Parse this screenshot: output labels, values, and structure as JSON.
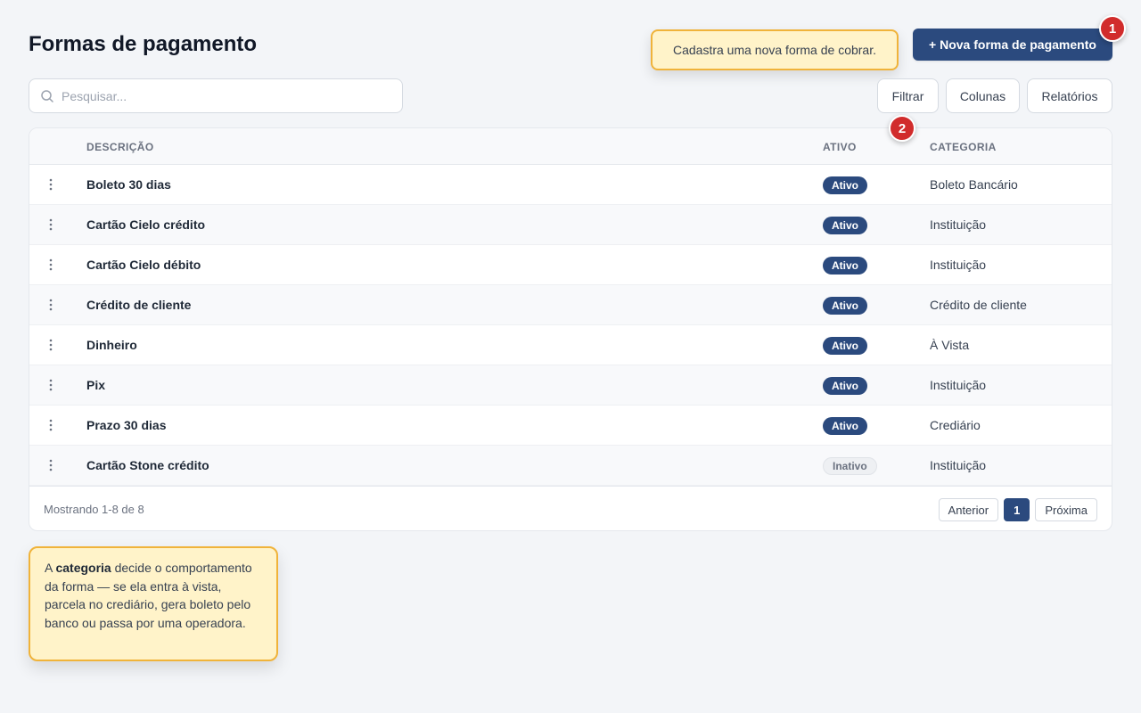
{
  "header": {
    "title": "Formas de pagamento",
    "new_button": "+ Nova forma de pagamento"
  },
  "tooltips": {
    "new_button_hint": "Cadastra uma nova forma de cobrar.",
    "category_prefix": "A ",
    "category_bold": "categoria",
    "category_rest": " decide o comportamento da forma — se ela entra à vista, parcela no crediário, gera boleto pelo banco ou passa por uma operadora."
  },
  "steps": [
    "1",
    "2"
  ],
  "toolbar": {
    "search_placeholder": "Pesquisar...",
    "filter": "Filtrar",
    "columns": "Colunas",
    "reports": "Relatórios"
  },
  "table": {
    "columns": [
      "DESCRIÇÃO",
      "ATIVO",
      "CATEGORIA"
    ],
    "rows": [
      {
        "description": "Boleto 30 dias",
        "status": "Ativo",
        "active": true,
        "category": "Boleto Bancário"
      },
      {
        "description": "Cartão Cielo crédito",
        "status": "Ativo",
        "active": true,
        "category": "Instituição"
      },
      {
        "description": "Cartão Cielo débito",
        "status": "Ativo",
        "active": true,
        "category": "Instituição"
      },
      {
        "description": "Crédito de cliente",
        "status": "Ativo",
        "active": true,
        "category": "Crédito de cliente"
      },
      {
        "description": "Dinheiro",
        "status": "Ativo",
        "active": true,
        "category": "À Vista"
      },
      {
        "description": "Pix",
        "status": "Ativo",
        "active": true,
        "category": "Instituição"
      },
      {
        "description": "Prazo 30 dias",
        "status": "Ativo",
        "active": true,
        "category": "Crediário"
      },
      {
        "description": "Cartão Stone crédito",
        "status": "Inativo",
        "active": false,
        "category": "Instituição"
      }
    ]
  },
  "footer": {
    "showing": "Mostrando 1-8 de 8",
    "prev": "Anterior",
    "page": "1",
    "next": "Próxima"
  },
  "colors": {
    "primary": "#2b4a7e",
    "step_badge": "#d12c2c",
    "tooltip_bg": "#fff3c9",
    "tooltip_border": "#f0b33a"
  }
}
